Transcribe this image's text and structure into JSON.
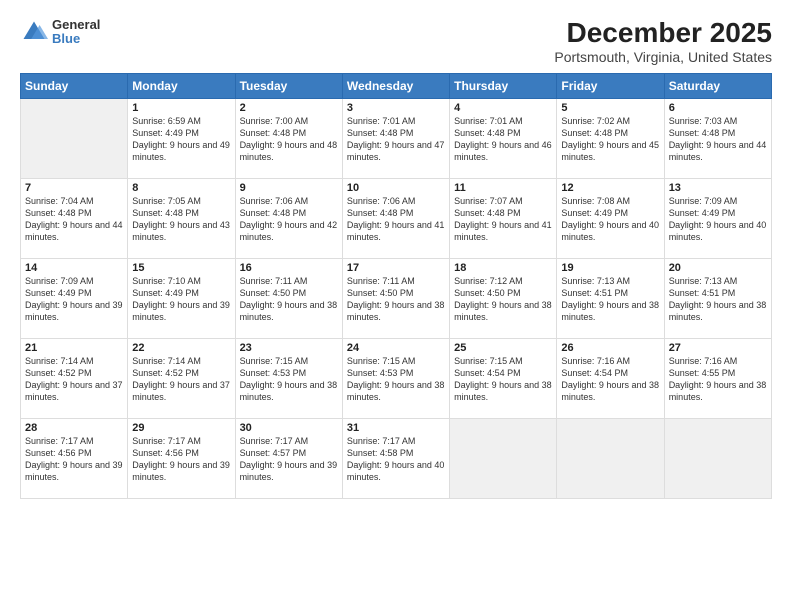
{
  "logo": {
    "line1": "General",
    "line2": "Blue"
  },
  "title": "December 2025",
  "subtitle": "Portsmouth, Virginia, United States",
  "days_of_week": [
    "Sunday",
    "Monday",
    "Tuesday",
    "Wednesday",
    "Thursday",
    "Friday",
    "Saturday"
  ],
  "weeks": [
    [
      {
        "num": "",
        "empty": true
      },
      {
        "num": "1",
        "sunrise": "6:59 AM",
        "sunset": "4:49 PM",
        "daylight": "9 hours and 49 minutes."
      },
      {
        "num": "2",
        "sunrise": "7:00 AM",
        "sunset": "4:48 PM",
        "daylight": "9 hours and 48 minutes."
      },
      {
        "num": "3",
        "sunrise": "7:01 AM",
        "sunset": "4:48 PM",
        "daylight": "9 hours and 47 minutes."
      },
      {
        "num": "4",
        "sunrise": "7:01 AM",
        "sunset": "4:48 PM",
        "daylight": "9 hours and 46 minutes."
      },
      {
        "num": "5",
        "sunrise": "7:02 AM",
        "sunset": "4:48 PM",
        "daylight": "9 hours and 45 minutes."
      },
      {
        "num": "6",
        "sunrise": "7:03 AM",
        "sunset": "4:48 PM",
        "daylight": "9 hours and 44 minutes."
      }
    ],
    [
      {
        "num": "7",
        "sunrise": "7:04 AM",
        "sunset": "4:48 PM",
        "daylight": "9 hours and 44 minutes."
      },
      {
        "num": "8",
        "sunrise": "7:05 AM",
        "sunset": "4:48 PM",
        "daylight": "9 hours and 43 minutes."
      },
      {
        "num": "9",
        "sunrise": "7:06 AM",
        "sunset": "4:48 PM",
        "daylight": "9 hours and 42 minutes."
      },
      {
        "num": "10",
        "sunrise": "7:06 AM",
        "sunset": "4:48 PM",
        "daylight": "9 hours and 41 minutes."
      },
      {
        "num": "11",
        "sunrise": "7:07 AM",
        "sunset": "4:48 PM",
        "daylight": "9 hours and 41 minutes."
      },
      {
        "num": "12",
        "sunrise": "7:08 AM",
        "sunset": "4:49 PM",
        "daylight": "9 hours and 40 minutes."
      },
      {
        "num": "13",
        "sunrise": "7:09 AM",
        "sunset": "4:49 PM",
        "daylight": "9 hours and 40 minutes."
      }
    ],
    [
      {
        "num": "14",
        "sunrise": "7:09 AM",
        "sunset": "4:49 PM",
        "daylight": "9 hours and 39 minutes."
      },
      {
        "num": "15",
        "sunrise": "7:10 AM",
        "sunset": "4:49 PM",
        "daylight": "9 hours and 39 minutes."
      },
      {
        "num": "16",
        "sunrise": "7:11 AM",
        "sunset": "4:50 PM",
        "daylight": "9 hours and 38 minutes."
      },
      {
        "num": "17",
        "sunrise": "7:11 AM",
        "sunset": "4:50 PM",
        "daylight": "9 hours and 38 minutes."
      },
      {
        "num": "18",
        "sunrise": "7:12 AM",
        "sunset": "4:50 PM",
        "daylight": "9 hours and 38 minutes."
      },
      {
        "num": "19",
        "sunrise": "7:13 AM",
        "sunset": "4:51 PM",
        "daylight": "9 hours and 38 minutes."
      },
      {
        "num": "20",
        "sunrise": "7:13 AM",
        "sunset": "4:51 PM",
        "daylight": "9 hours and 38 minutes."
      }
    ],
    [
      {
        "num": "21",
        "sunrise": "7:14 AM",
        "sunset": "4:52 PM",
        "daylight": "9 hours and 37 minutes."
      },
      {
        "num": "22",
        "sunrise": "7:14 AM",
        "sunset": "4:52 PM",
        "daylight": "9 hours and 37 minutes."
      },
      {
        "num": "23",
        "sunrise": "7:15 AM",
        "sunset": "4:53 PM",
        "daylight": "9 hours and 38 minutes."
      },
      {
        "num": "24",
        "sunrise": "7:15 AM",
        "sunset": "4:53 PM",
        "daylight": "9 hours and 38 minutes."
      },
      {
        "num": "25",
        "sunrise": "7:15 AM",
        "sunset": "4:54 PM",
        "daylight": "9 hours and 38 minutes."
      },
      {
        "num": "26",
        "sunrise": "7:16 AM",
        "sunset": "4:54 PM",
        "daylight": "9 hours and 38 minutes."
      },
      {
        "num": "27",
        "sunrise": "7:16 AM",
        "sunset": "4:55 PM",
        "daylight": "9 hours and 38 minutes."
      }
    ],
    [
      {
        "num": "28",
        "sunrise": "7:17 AM",
        "sunset": "4:56 PM",
        "daylight": "9 hours and 39 minutes."
      },
      {
        "num": "29",
        "sunrise": "7:17 AM",
        "sunset": "4:56 PM",
        "daylight": "9 hours and 39 minutes."
      },
      {
        "num": "30",
        "sunrise": "7:17 AM",
        "sunset": "4:57 PM",
        "daylight": "9 hours and 39 minutes."
      },
      {
        "num": "31",
        "sunrise": "7:17 AM",
        "sunset": "4:58 PM",
        "daylight": "9 hours and 40 minutes."
      },
      {
        "num": "",
        "empty": true
      },
      {
        "num": "",
        "empty": true
      },
      {
        "num": "",
        "empty": true
      }
    ]
  ]
}
